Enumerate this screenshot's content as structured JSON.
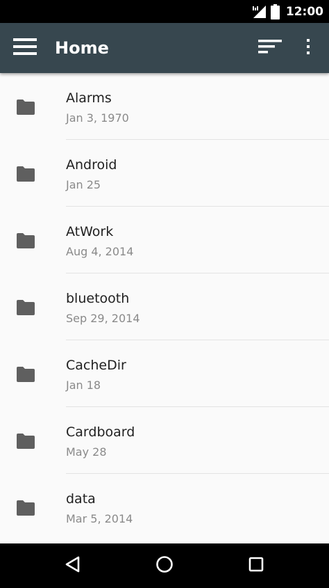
{
  "status_bar": {
    "time": "12:00",
    "icons": [
      "signal-icon",
      "battery-icon"
    ]
  },
  "toolbar": {
    "title": "Home",
    "color": "#37474f",
    "actions": [
      "menu-icon",
      "sort-icon",
      "more-vert-icon"
    ]
  },
  "files": [
    {
      "name": "Alarms",
      "date": "Jan 3, 1970",
      "icon": "folder-icon"
    },
    {
      "name": "Android",
      "date": "Jan 25",
      "icon": "folder-icon"
    },
    {
      "name": "AtWork",
      "date": "Aug 4, 2014",
      "icon": "folder-icon"
    },
    {
      "name": "bluetooth",
      "date": "Sep 29, 2014",
      "icon": "folder-icon"
    },
    {
      "name": "CacheDir",
      "date": "Jan 18",
      "icon": "folder-icon"
    },
    {
      "name": "Cardboard",
      "date": "May 28",
      "icon": "folder-icon"
    },
    {
      "name": "data",
      "date": "Mar 5, 2014",
      "icon": "folder-icon"
    }
  ],
  "nav_bar": {
    "buttons": [
      "back-icon",
      "home-icon",
      "recents-icon"
    ]
  }
}
